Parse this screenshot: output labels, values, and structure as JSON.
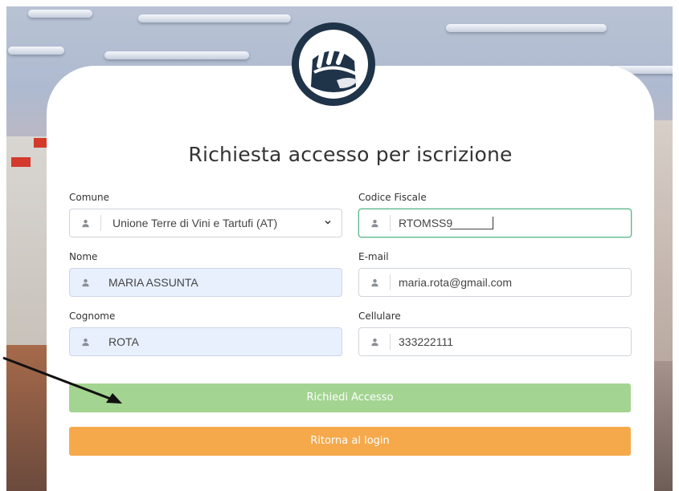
{
  "page": {
    "title": "Richiesta accesso per iscrizione"
  },
  "form": {
    "comune": {
      "label": "Comune",
      "value": "Unione Terre di Vini e Tartufi (AT)"
    },
    "codice_fiscale": {
      "label": "Codice Fiscale",
      "value": "RTOMSS9"
    },
    "nome": {
      "label": "Nome",
      "value": "MARIA ASSUNTA"
    },
    "email": {
      "label": "E-mail",
      "value": "maria.rota@gmail.com"
    },
    "cognome": {
      "label": "Cognome",
      "value": "ROTA"
    },
    "cellulare": {
      "label": "Cellulare",
      "value": "333222111"
    }
  },
  "buttons": {
    "request_access": "Richiedi Accesso",
    "back_to_login": "Ritorna al login"
  },
  "icons": {
    "field_icon": "user-icon",
    "logo": "helmet-logo",
    "select_caret": "chevron-down-icon",
    "annotation": "arrow-icon"
  },
  "colors": {
    "primary_green": "#a3d491",
    "secondary_orange": "#f5a94b",
    "logo_navy": "#1f3349",
    "focus_border": "#5cb88a",
    "autofill_bg": "#e8f0fe"
  }
}
